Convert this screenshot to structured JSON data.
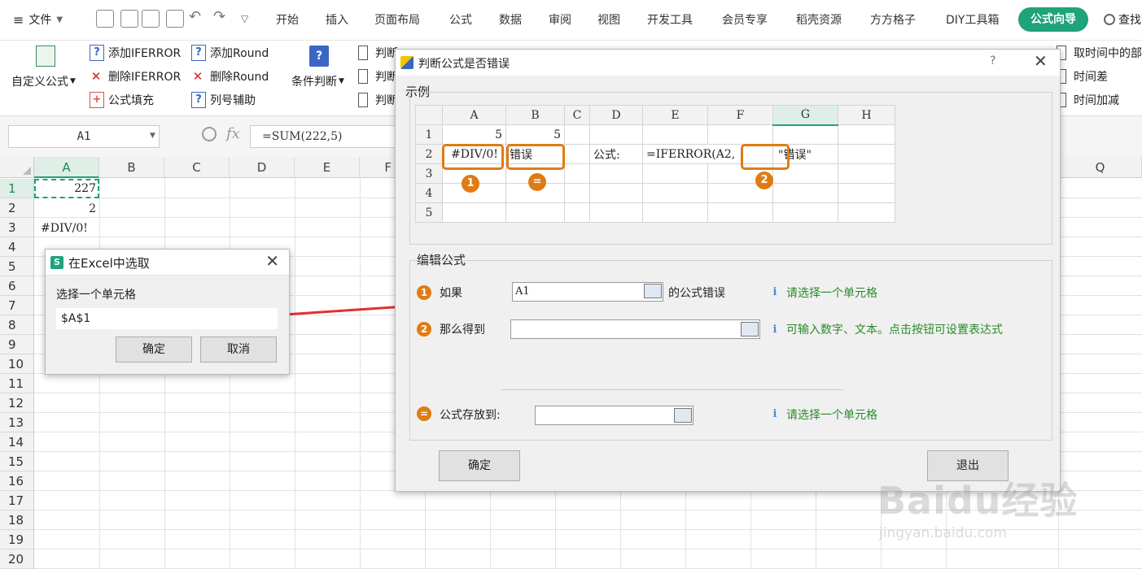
{
  "menubar": {
    "file_label": "文件",
    "tabs": [
      "开始",
      "插入",
      "页面布局",
      "公式",
      "数据",
      "审阅",
      "视图",
      "开发工具",
      "会员专享",
      "稻壳资源",
      "方方格子",
      "DIY工具箱"
    ],
    "active_tab": "公式向导",
    "search_label": "查找"
  },
  "ribbon": {
    "custom_formula": "自定义公式",
    "add_iferror": "添加IFERROR",
    "remove_iferror": "删除IFERROR",
    "formula_fill": "公式填充",
    "add_round": "添加Round",
    "remove_round": "删除Round",
    "col_helper": "列号辅助",
    "cond_judge": "条件判断",
    "judge1": "判断",
    "judge2": "判断",
    "judge3": "判断",
    "time_part": "取时间中的部",
    "time_diff": "时间差",
    "time_add": "时间加减"
  },
  "formula_bar": {
    "name_box": "A1",
    "fx": "fx",
    "formula": "=SUM(222,5)"
  },
  "sheet": {
    "columns": [
      "A",
      "B",
      "C",
      "D",
      "E",
      "F",
      "Q"
    ],
    "rows": [
      "1",
      "2",
      "3",
      "4",
      "5",
      "6",
      "7",
      "8",
      "9",
      "10",
      "11",
      "12",
      "13",
      "14",
      "15",
      "16",
      "17",
      "18",
      "19",
      "20"
    ],
    "a1": "227",
    "a2": "2",
    "a3": "#DIV/0!"
  },
  "select_dialog": {
    "title": "在Excel中选取",
    "prompt": "选择一个单元格",
    "value": "$A$1",
    "ok": "确定",
    "cancel": "取消"
  },
  "main_dialog": {
    "title": "判断公式是否错误",
    "help": "?",
    "example_label": "示例",
    "example": {
      "cols": [
        "A",
        "B",
        "C",
        "D",
        "E",
        "F",
        "G",
        "H"
      ],
      "rows": [
        "1",
        "2",
        "3",
        "4",
        "5"
      ],
      "a1": "5",
      "b1": "5",
      "a2": "#DIV/0!",
      "b2": "错误",
      "d2": "公式:",
      "e2": "=IFERROR(A2,",
      "g2": "\"错误\"",
      "badge1": "1",
      "badge2": "2",
      "badge_eq": "="
    },
    "edit_label": "编辑公式",
    "if_label": "如果",
    "if_value": "A1",
    "if_suffix": "的公式错误",
    "if_hint": "请选择一个单元格",
    "then_label": "那么得到",
    "then_value": "",
    "then_hint": "可输入数字、文本。点击按钮可设置表达式",
    "store_label": "公式存放到:",
    "store_value": "",
    "store_hint": "请选择一个单元格",
    "ok": "确定",
    "exit": "退出"
  },
  "watermark": {
    "brand": "Baidu经验",
    "url": "jingyan.baidu.com"
  },
  "colors": {
    "accent": "#1fa37a",
    "orange": "#e07b14",
    "hint_green": "#2a8a2a",
    "arrow_red": "#e03030"
  }
}
